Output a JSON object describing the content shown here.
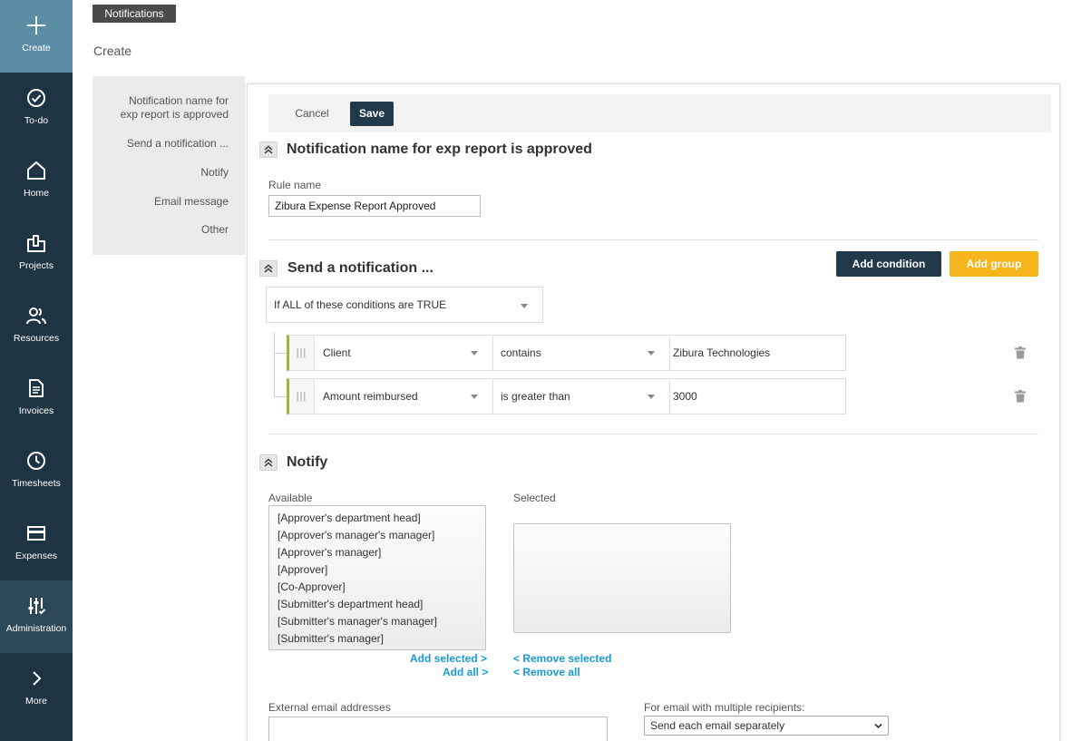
{
  "nav": {
    "create": "Create",
    "todo": "To-do",
    "home": "Home",
    "projects": "Projects",
    "resources": "Resources",
    "invoices": "Invoices",
    "timesheets": "Timesheets",
    "expenses": "Expenses",
    "administration": "Administration",
    "more": "More"
  },
  "header": {
    "badge": "Notifications",
    "title": "Create"
  },
  "section_nav": {
    "items": [
      "Notification name for",
      "exp report is approved",
      "Send a notification ...",
      "Notify",
      "Email message",
      "Other"
    ]
  },
  "toolbar": {
    "cancel": "Cancel",
    "save": "Save"
  },
  "section_name": {
    "title": "Notification name for exp report is approved",
    "rule_label": "Rule name",
    "rule_value": "Zibura Expense Report Approved"
  },
  "section_send": {
    "title": "Send a notification ...",
    "add_condition": "Add condition",
    "add_group": "Add group",
    "logic": "If ALL of these conditions are TRUE",
    "conditions": [
      {
        "field": "Client",
        "operator": "contains",
        "value": "Zibura Technologies"
      },
      {
        "field": "Amount reimbursed",
        "operator": "is greater than",
        "value": "3000"
      }
    ]
  },
  "section_notify": {
    "title": "Notify",
    "available_label": "Available",
    "selected_label": "Selected",
    "available": [
      "[Approver's department head]",
      "[Approver's manager's manager]",
      "[Approver's manager]",
      "[Approver]",
      "[Co-Approver]",
      "[Submitter's department head]",
      "[Submitter's manager's manager]",
      "[Submitter's manager]"
    ],
    "add_selected": "Add selected >",
    "add_all": "Add all >",
    "remove_selected": "< Remove selected",
    "remove_all": "< Remove all",
    "external_label": "External email addresses",
    "external_value": "",
    "multi_label": "For email with multiple recipients:",
    "multi_value": "Send each email separately"
  },
  "colors": {
    "rail": "#1f3442",
    "rail_create": "#5b8ea5",
    "primary_button": "#22394a",
    "accent_yellow": "#f6b51d",
    "link": "#1a9bd7",
    "condition_bar": "#9cb83a"
  }
}
